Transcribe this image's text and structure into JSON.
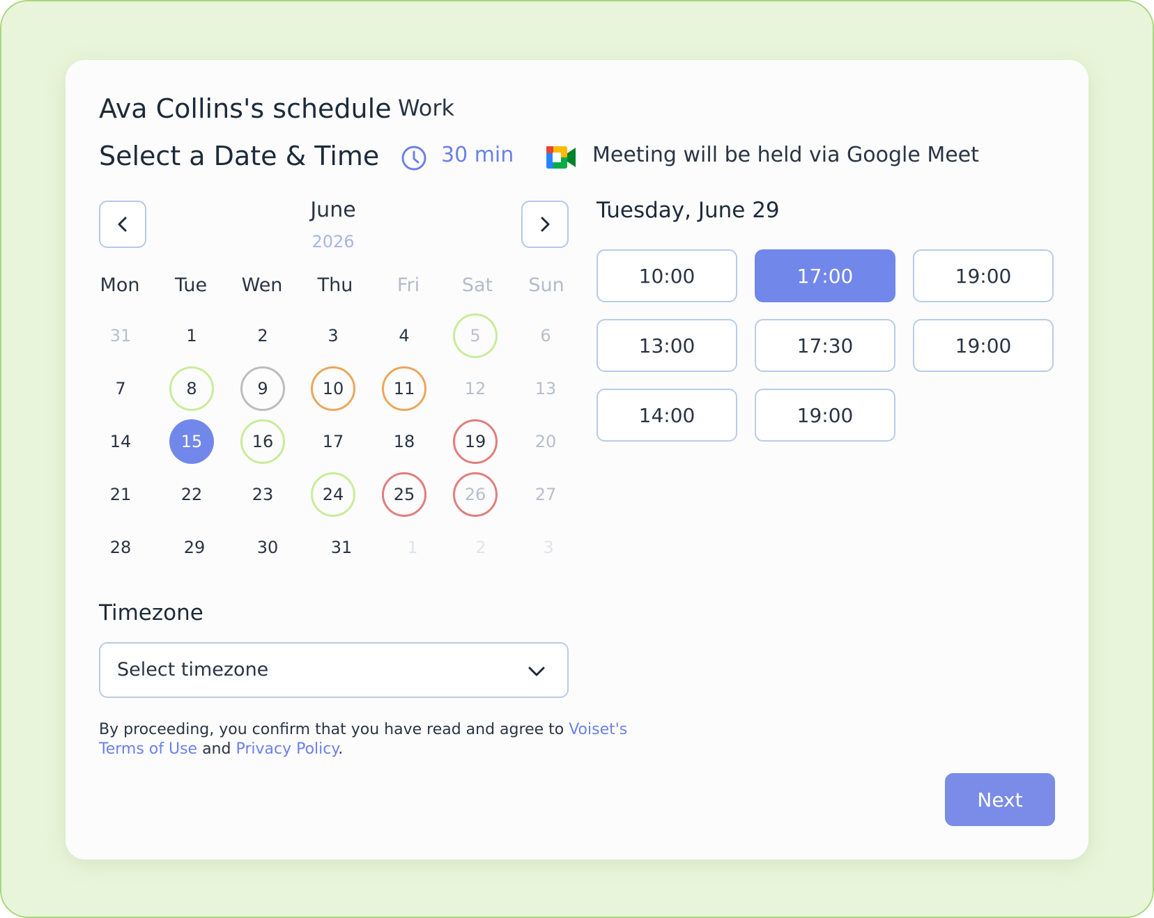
{
  "header": {
    "title": "Ava Collins's schedule",
    "tag": "Work",
    "subtitle": "Select a Date & Time",
    "duration": "30 min",
    "duration_icon": "clock-icon",
    "meeting_icon": "google-meet-icon",
    "meeting_text": "Meeting will be held via Google Meet"
  },
  "calendar": {
    "month": "June",
    "year": "2026",
    "prev_icon": "chevron-left-icon",
    "next_icon": "chevron-right-icon",
    "weekdays": [
      "Mon",
      "Tue",
      "Wen",
      "Thu",
      "Fri",
      "Sat",
      "Sun"
    ],
    "weeks": [
      [
        "31",
        "1",
        "2",
        "3",
        "4",
        "5",
        "6"
      ],
      [
        "7",
        "8",
        "9",
        "10",
        "11",
        "12",
        "13"
      ],
      [
        "14",
        "15",
        "16",
        "17",
        "18",
        "19",
        "20"
      ],
      [
        "21",
        "22",
        "23",
        "24",
        "25",
        "26",
        "27"
      ],
      [
        "28",
        "29",
        "30",
        "31",
        "1",
        "2",
        "3"
      ]
    ],
    "selected_day": "15"
  },
  "slots": {
    "date_heading": "Tuesday, June 29",
    "times": [
      "10:00",
      "17:00",
      "19:00",
      "13:00",
      "17:30",
      "19:00",
      "14:00",
      "19:00"
    ],
    "selected": "17:00"
  },
  "timezone": {
    "label": "Timezone",
    "placeholder": "Select timezone",
    "chevron_icon": "chevron-down-icon"
  },
  "legal": {
    "prefix": "By proceeding, you confirm that you have read and agree to ",
    "company_link": "Voiset's",
    "terms_link": "Terms of Use",
    "conjunction": " and ",
    "privacy_link": "Privacy Policy",
    "suffix": "."
  },
  "actions": {
    "next_label": "Next"
  },
  "colors": {
    "accent": "#7287ea",
    "frame_bg": "#e9f5da",
    "ring_green": "#c9ec9a",
    "ring_orange": "#eca65a",
    "ring_red": "#e27d7d",
    "ring_gray": "#bcbcbc"
  }
}
